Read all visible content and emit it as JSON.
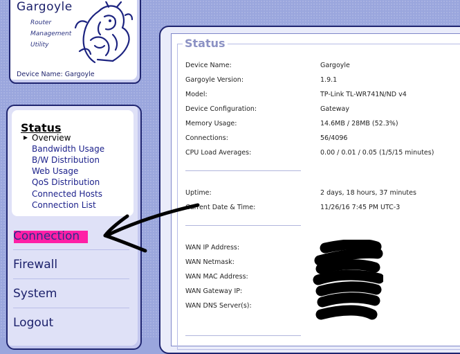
{
  "logo": {
    "title": "Gargoyle",
    "subtitle": [
      "Router",
      "Management",
      "Utility"
    ],
    "device_name": "Device Name: Gargoyle"
  },
  "nav": {
    "status_title": "Status",
    "status_items": [
      {
        "label": "Overview",
        "active": true
      },
      {
        "label": "Bandwidth Usage"
      },
      {
        "label": "B/W Distribution"
      },
      {
        "label": "Web Usage"
      },
      {
        "label": "QoS Distribution"
      },
      {
        "label": "Connected Hosts"
      },
      {
        "label": "Connection List"
      }
    ],
    "main_items": [
      "Connection",
      "Firewall",
      "System",
      "Logout"
    ]
  },
  "main": {
    "section_title": "Status",
    "group1": [
      {
        "label": "Device Name:",
        "value": "Gargoyle"
      },
      {
        "label": "Gargoyle Version:",
        "value": "1.9.1"
      },
      {
        "label": "Model:",
        "value": "TP-Link TL-WR741N/ND v4"
      },
      {
        "label": "Device Configuration:",
        "value": "Gateway"
      },
      {
        "label": "Memory Usage:",
        "value": "14.6MB / 28MB (52.3%)"
      },
      {
        "label": "Connections:",
        "value": "56/4096"
      },
      {
        "label": "CPU Load Averages:",
        "value": "0.00 / 0.01 / 0.05  (1/5/15 minutes)"
      }
    ],
    "group2": [
      {
        "label": "Uptime:",
        "value": "2 days, 18 hours, 37 minutes"
      },
      {
        "label": "Current Date & Time:",
        "value": "11/26/16 7:45 PM UTC-3"
      }
    ],
    "group3": [
      {
        "label": "WAN IP Address:"
      },
      {
        "label": "WAN Netmask:"
      },
      {
        "label": "WAN MAC Address:"
      },
      {
        "label": "WAN Gateway IP:"
      },
      {
        "label": "WAN DNS Server(s):"
      }
    ]
  },
  "colors": {
    "background": "#9aa6dd",
    "panel_border": "#1f2570",
    "highlight": "#ff1fa6",
    "section_title": "#8c92c4",
    "nav_link": "#1a1f8a"
  },
  "icons": [
    "gargoyle-logo-icon",
    "arrow-annotation-icon",
    "redaction-scribble-icon"
  ]
}
